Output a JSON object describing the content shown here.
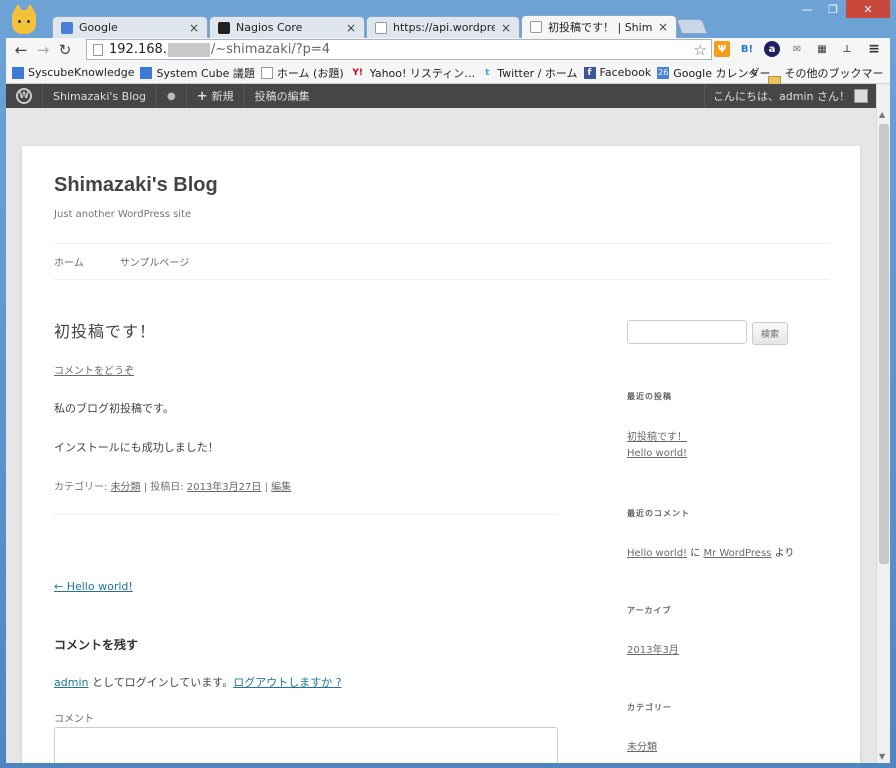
{
  "tabs": [
    {
      "title": "Google",
      "favicon": "google-favicon",
      "color": "#4a7fd9"
    },
    {
      "title": "Nagios Core",
      "favicon": "nagios-favicon",
      "color": "#222222"
    },
    {
      "title": "https://api.wordpress.o",
      "favicon": "page-favicon",
      "color": "#ffffff"
    },
    {
      "title": "初投稿です！ | Shimaza",
      "favicon": "page-favicon",
      "color": "#ffffff"
    }
  ],
  "tab_close": "×",
  "window_controls": {
    "minimize": "—",
    "maximize": "❐",
    "close": "✕"
  },
  "toolbar": {
    "back": "←",
    "forward": "→",
    "reload": "↻",
    "menu": "≡"
  },
  "address": {
    "host": "192.168.",
    "path": "/~shimazaki/?p=4",
    "star": "☆"
  },
  "extensions": [
    {
      "name": "fork-icon",
      "glyph": "Ψ",
      "color": "#f2a01c"
    },
    {
      "name": "hatena-bookmark-icon",
      "glyph": "B!",
      "color": "#1b7bd6"
    },
    {
      "name": "a-icon",
      "glyph": "a",
      "color": "#1e1e60"
    },
    {
      "name": "mail-icon",
      "glyph": "✉",
      "color": "#777777"
    },
    {
      "name": "qr-icon",
      "glyph": "▦",
      "color": "#333333"
    },
    {
      "name": "dropper-icon",
      "glyph": "⊥",
      "color": "#555555"
    }
  ],
  "bookmarks": [
    {
      "label": "SyscubeKnowledge",
      "icon": "■",
      "color": "#3b7bd4"
    },
    {
      "label": "System Cube 議題",
      "icon": "■",
      "color": "#3b7bd4"
    },
    {
      "label": "ホーム (お題)",
      "icon": "□",
      "color": "#999999"
    },
    {
      "label": "Yahoo! リスティン…",
      "icon": "Y!",
      "color": "#d0021b"
    },
    {
      "label": "Twitter / ホーム",
      "icon": "t",
      "color": "#3aa3e3"
    },
    {
      "label": "Facebook",
      "icon": "f",
      "color": "#3b5998"
    },
    {
      "label": "Google カレンダー",
      "icon": "26",
      "color": "#4a7fd9"
    }
  ],
  "bookmarks_more": "»",
  "bookmarks_folder": "その他のブックマーク",
  "adminbar": {
    "logo": "W",
    "site": "Shimazaki's Blog",
    "comments_icon": "●",
    "new_plus": "+",
    "new": "新規",
    "edit": "投稿の編集",
    "howdy": "こんにちは、admin さん！",
    "search_icon": "⚲"
  },
  "scrollbar": {
    "up": "▲",
    "down": "▼"
  },
  "site": {
    "title": "Shimazaki's Blog",
    "description": "Just another WordPress site",
    "nav": [
      "ホーム",
      "サンプルページ"
    ]
  },
  "post": {
    "title": "初投稿です！",
    "comments_link": "コメントをどうぞ",
    "paragraphs": [
      "私のブログ初投稿です。",
      "インストールにも成功しました！"
    ],
    "meta": {
      "category_label": "カテゴリー: ",
      "category": "未分類",
      "sep1": " | 投稿日: ",
      "date": "2013年3月27日",
      "sep2": " | ",
      "edit": "編集"
    },
    "prev_link": "← Hello world!",
    "reply_title": "コメントを残す",
    "logged_in": {
      "user": "admin",
      "text": " としてログインしています。",
      "logout": "ログアウトしますか ?"
    },
    "comment_label": "コメント"
  },
  "sidebar": {
    "search_button": "検索",
    "recent_posts_title": "最近の投稿",
    "recent_posts": [
      "初投稿です！",
      "Hello world!"
    ],
    "recent_comments_title": "最近のコメント",
    "recent_comment": {
      "post": "Hello world!",
      "on": " に ",
      "author": "Mr WordPress",
      "suffix": " より"
    },
    "archives_title": "アーカイブ",
    "archives": [
      "2013年3月"
    ],
    "categories_title": "カテゴリー",
    "categories": [
      "未分類"
    ]
  }
}
